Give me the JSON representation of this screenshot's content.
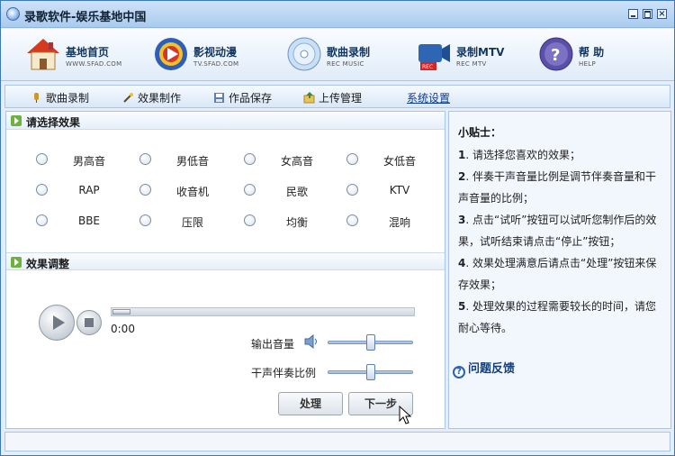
{
  "window": {
    "title": "录歌软件-娱乐基地中国"
  },
  "colors": {
    "accent": "#13365f",
    "panel_border": "#a9c6e8",
    "section_arrow": "#6db23a"
  },
  "toolbar": {
    "items": [
      {
        "label": "基地首页",
        "sub": "WWW.SFAD.COM",
        "icon": "house-icon"
      },
      {
        "label": "影视动漫",
        "sub": "TV.SFAD.COM",
        "icon": "media-player-icon"
      },
      {
        "label": "歌曲录制",
        "sub": "REC MUSIC",
        "icon": "cd-disc-icon"
      },
      {
        "label": "录制MTV",
        "sub": "REC MTV",
        "icon": "camera-rec-icon"
      },
      {
        "label": "帮    助",
        "sub": "HELP",
        "icon": "help-icon"
      }
    ]
  },
  "tabs": [
    {
      "label": "歌曲录制"
    },
    {
      "label": "效果制作"
    },
    {
      "label": "作品保存"
    },
    {
      "label": "上传管理"
    },
    {
      "label": "系统设置"
    }
  ],
  "effects": {
    "title": "请选择效果",
    "options": [
      "男高音",
      "男低音",
      "女高音",
      "女低音",
      "RAP",
      "收音机",
      "民歌",
      "KTV",
      "BBE",
      "压限",
      "均衡",
      "混响"
    ]
  },
  "adjust": {
    "title": "效果调整",
    "time": "0:00",
    "progress": 0,
    "output_volume_label": "输出音量",
    "output_volume": 0.5,
    "dry_ratio_label": "干声伴奏比例",
    "dry_ratio": 0.5,
    "process_label": "处理",
    "next_label": "下一步"
  },
  "tips": {
    "title": "小贴士：",
    "items": [
      {
        "num": "1",
        "text": ". 请选择您喜欢的效果；"
      },
      {
        "num": "2",
        "text": ". 伴奏干声音量比例是调节伴奏音量和干声音量的比例；"
      },
      {
        "num": "3",
        "text": ". 点击“试听”按钮可以试听您制作后的效果，试听结束请点击“停止”按钮；"
      },
      {
        "num": "4",
        "text": ". 效果处理满意后请点击“处理”按钮来保存效果；"
      },
      {
        "num": "5",
        "text": ". 处理效果的过程需要较长的时间，请您耐心等待。"
      }
    ],
    "feedback": "问题反馈"
  }
}
